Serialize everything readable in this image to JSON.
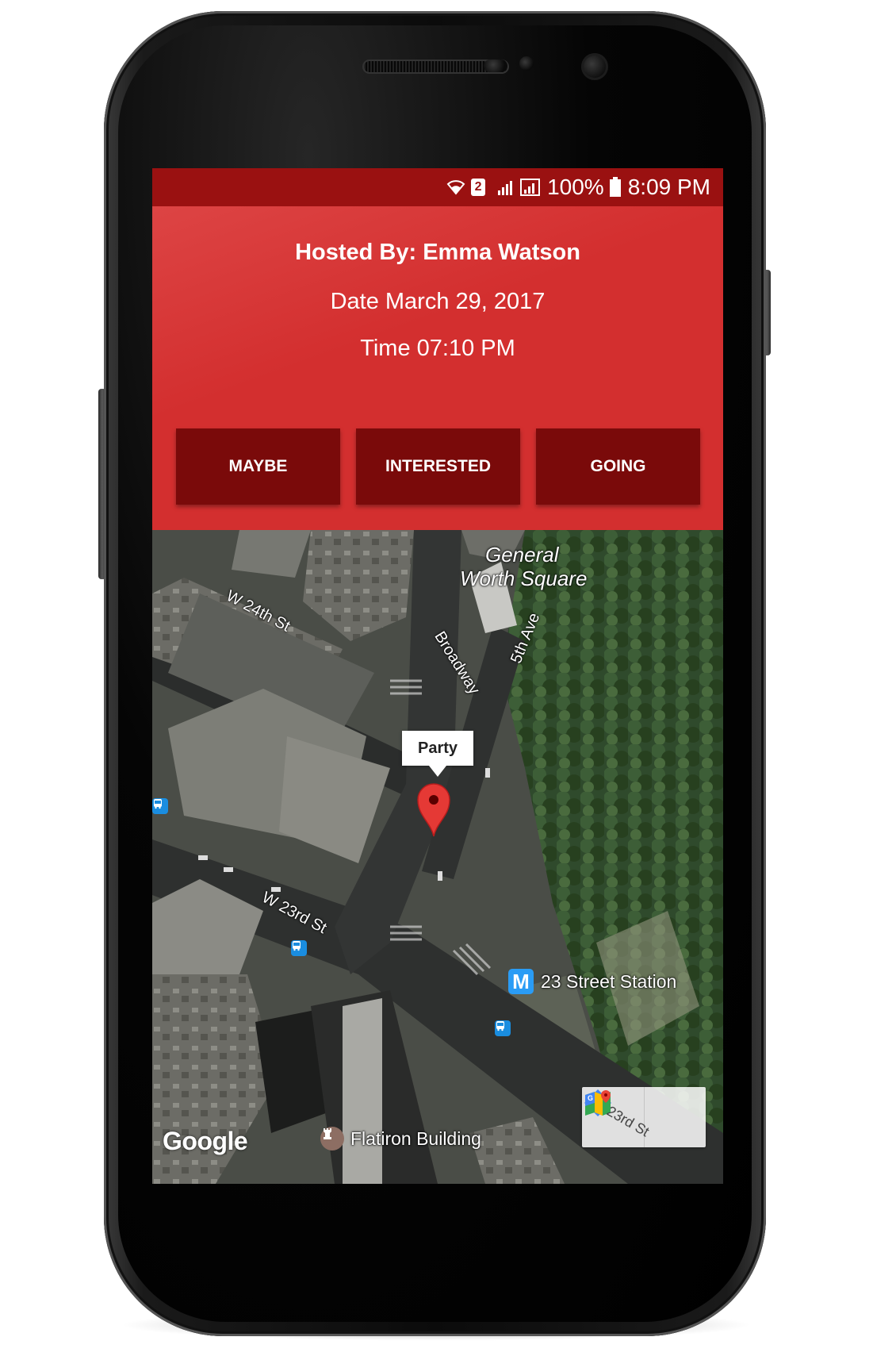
{
  "status_bar": {
    "sim_number": "2",
    "battery": "100%",
    "time": "8:09 PM"
  },
  "event": {
    "host": "Hosted By: Emma Watson",
    "date": "Date March 29, 2017",
    "time": "Time 07:10 PM"
  },
  "actions": {
    "maybe_label": "MAYBE",
    "interested_label": "INTERESTED",
    "going_label": "GOING"
  },
  "map": {
    "marker_title": "Party",
    "labels": {
      "square": "General",
      "square_line2": "Worth Square",
      "w24": "W 24th St",
      "broadway": "Broadway",
      "fifth_ave": "5th Ave",
      "w23": "W 23rd St",
      "station": "23 Street Station",
      "station_badge": "M",
      "flatiron": "Flatiron Building",
      "st23": "23rd St"
    },
    "attribution": "Google",
    "toolbar": {
      "directions_icon": "directions-icon",
      "open_maps_icon": "google-maps-icon"
    }
  },
  "colors": {
    "primary": "#d32f2f",
    "status_bar": "#9a1111",
    "button": "#7a0a0a",
    "pin": "#e53935"
  }
}
